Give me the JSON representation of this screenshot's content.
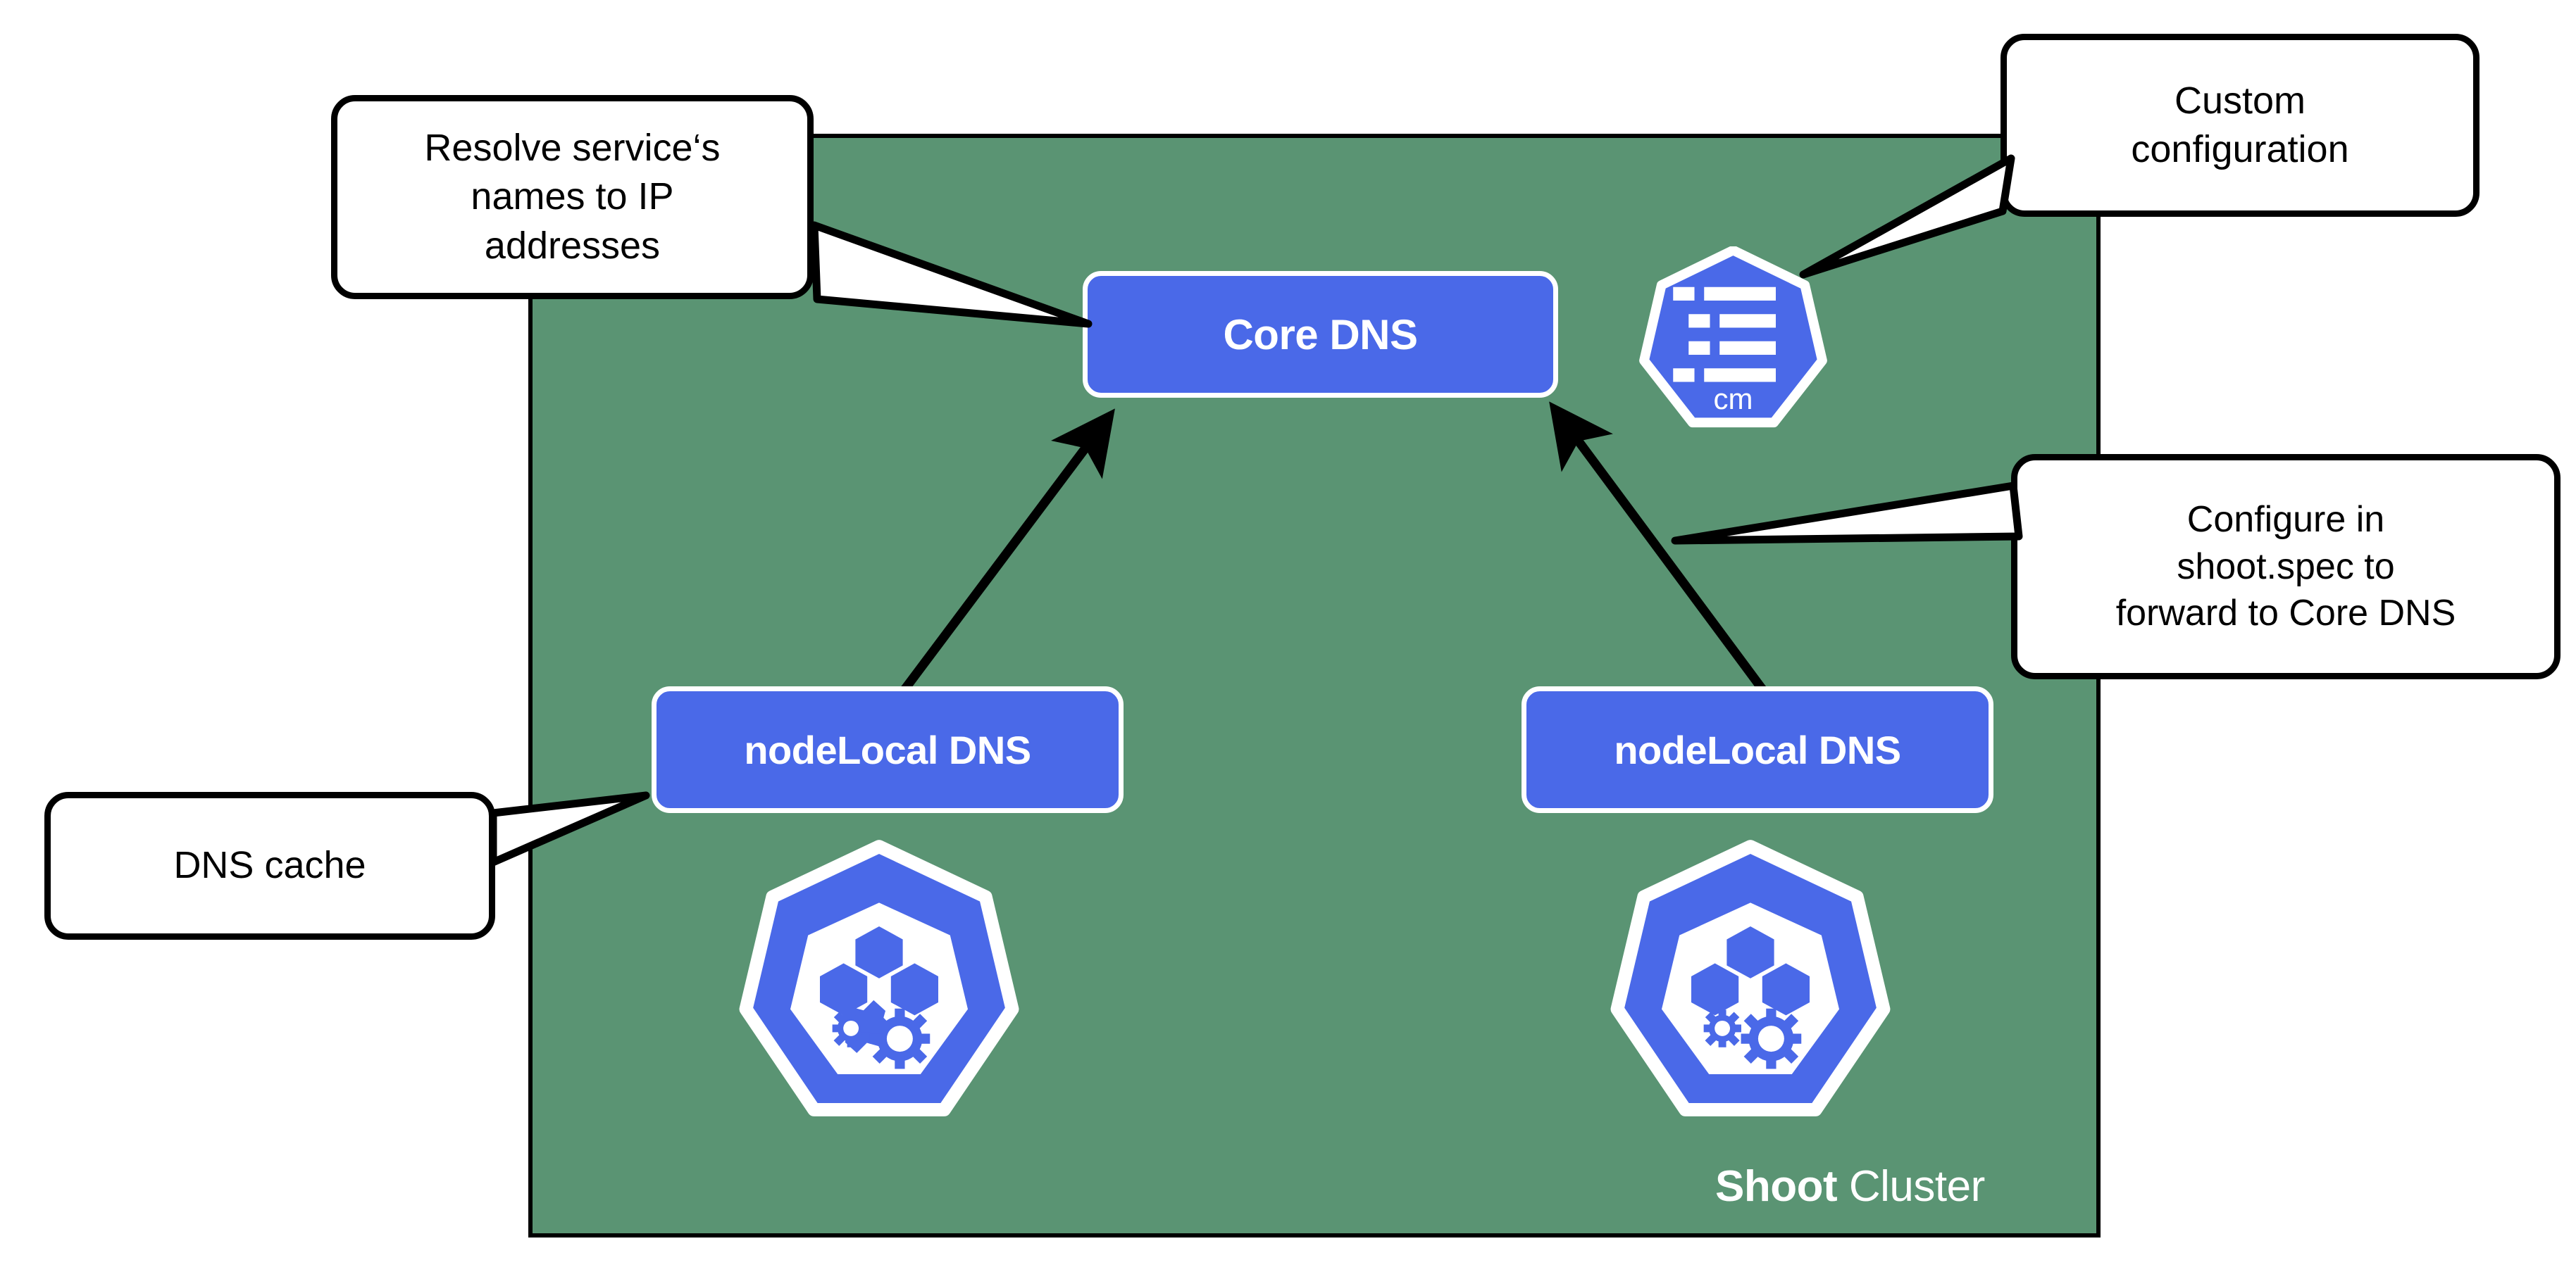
{
  "diagram": {
    "type": "architecture-diagram",
    "title": "Shoot Cluster DNS Architecture",
    "background_color": "#ffffff"
  },
  "cluster": {
    "label_bold": "Shoot",
    "label_regular": " Cluster",
    "fill_color": "#5a9473",
    "border_color": "#000000",
    "name": "shoot-cluster"
  },
  "nodes": [
    {
      "id": "core-dns",
      "label": "Core DNS",
      "color": "#4a69e8",
      "text_color": "#ffffff",
      "kind": "service-box"
    },
    {
      "id": "nodelocal-dns-left",
      "label": "nodeLocal DNS",
      "color": "#4a69e8",
      "text_color": "#ffffff",
      "kind": "service-box"
    },
    {
      "id": "nodelocal-dns-right",
      "label": "nodeLocal DNS",
      "color": "#4a69e8",
      "text_color": "#ffffff",
      "kind": "service-box"
    }
  ],
  "icons": [
    {
      "id": "configmap-icon",
      "name": "configmap-icon",
      "sublabel": "cm",
      "color": "#4a69e8",
      "outline_color": "#ffffff",
      "kind": "kubernetes-heptagon"
    },
    {
      "id": "node-icon-left",
      "name": "kubernetes-node-icon",
      "sublabel": "",
      "color": "#4a69e8",
      "outline_color": "#ffffff",
      "kind": "kubernetes-heptagon"
    },
    {
      "id": "node-icon-right",
      "name": "kubernetes-node-icon",
      "sublabel": "",
      "color": "#4a69e8",
      "outline_color": "#ffffff",
      "kind": "kubernetes-heptagon"
    }
  ],
  "callouts": [
    {
      "id": "callout-resolve",
      "name": "callout-resolve-service-names",
      "lines": [
        "Resolve service‘s",
        "names to IP",
        "addresses"
      ],
      "points_to": "core-dns"
    },
    {
      "id": "callout-custom-config",
      "name": "callout-custom-configuration",
      "lines": [
        "Custom",
        "configuration"
      ],
      "points_to": "configmap-icon"
    },
    {
      "id": "callout-configure-shoot",
      "name": "callout-configure-shoot-spec",
      "lines": [
        "Configure in",
        "shoot.spec to",
        "forward to Core DNS"
      ],
      "points_to": "nodelocal-dns-right"
    },
    {
      "id": "callout-dns-cache",
      "name": "callout-dns-cache",
      "lines": [
        "DNS cache"
      ],
      "points_to": "nodelocal-dns-left"
    }
  ],
  "connections": [
    {
      "id": "arrow-left-nodelocal-to-coredns",
      "from": "nodelocal-dns-left",
      "to": "core-dns",
      "style": "solid-arrow"
    },
    {
      "id": "arrow-right-nodelocal-to-coredns",
      "from": "nodelocal-dns-right",
      "to": "core-dns",
      "style": "solid-arrow"
    }
  ],
  "colors": {
    "cluster_green": "#5a9473",
    "service_blue": "#4a69e8",
    "outline_black": "#000000",
    "white": "#ffffff"
  }
}
